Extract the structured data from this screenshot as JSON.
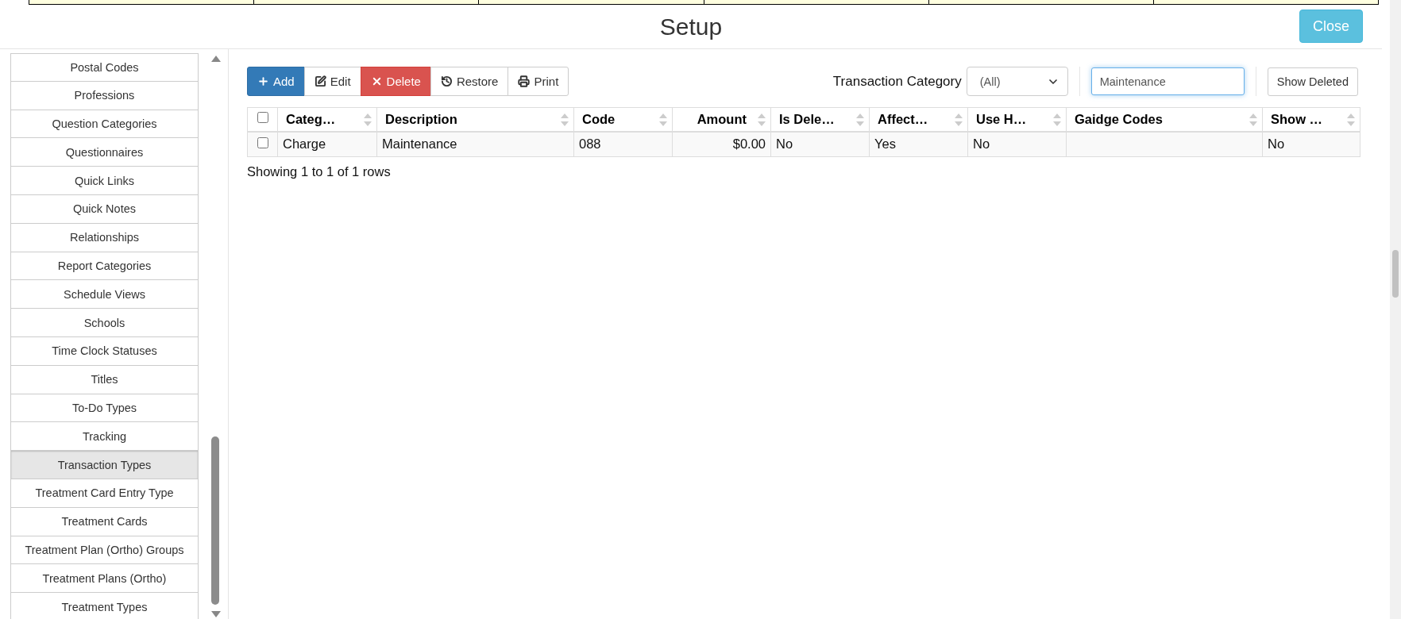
{
  "title": "Setup",
  "close_button": "Close",
  "sidebar": {
    "items": [
      {
        "label": "Postal Codes",
        "selected": false
      },
      {
        "label": "Professions",
        "selected": false
      },
      {
        "label": "Question Categories",
        "selected": false
      },
      {
        "label": "Questionnaires",
        "selected": false
      },
      {
        "label": "Quick Links",
        "selected": false
      },
      {
        "label": "Quick Notes",
        "selected": false
      },
      {
        "label": "Relationships",
        "selected": false
      },
      {
        "label": "Report Categories",
        "selected": false
      },
      {
        "label": "Schedule Views",
        "selected": false
      },
      {
        "label": "Schools",
        "selected": false
      },
      {
        "label": "Time Clock Statuses",
        "selected": false
      },
      {
        "label": "Titles",
        "selected": false
      },
      {
        "label": "To-Do Types",
        "selected": false
      },
      {
        "label": "Tracking",
        "selected": false
      },
      {
        "label": "Transaction Types",
        "selected": true
      },
      {
        "label": "Treatment Card Entry Type",
        "selected": false
      },
      {
        "label": "Treatment Cards",
        "selected": false
      },
      {
        "label": "Treatment Plan (Ortho) Groups",
        "selected": false
      },
      {
        "label": "Treatment Plans (Ortho)",
        "selected": false
      },
      {
        "label": "Treatment Types",
        "selected": false
      }
    ]
  },
  "toolbar": {
    "buttons": [
      {
        "label": "Add",
        "kind": "add"
      },
      {
        "label": "Edit",
        "kind": "edit"
      },
      {
        "label": "Delete",
        "kind": "delete"
      },
      {
        "label": "Restore",
        "kind": "restore"
      },
      {
        "label": "Print",
        "kind": "print"
      }
    ]
  },
  "filter": {
    "label": "Transaction Category",
    "select_value": "(All)",
    "search_value": "Maintenance",
    "show_deleted_button": "Show Deleted"
  },
  "table": {
    "select_all_checked": false,
    "columns": [
      {
        "label": "Categ…",
        "kind": "text"
      },
      {
        "label": "Description",
        "kind": "text"
      },
      {
        "label": "Code",
        "kind": "text"
      },
      {
        "label": "Amount",
        "kind": "amount"
      },
      {
        "label": "Is Dele…",
        "kind": "text"
      },
      {
        "label": "Affect…",
        "kind": "text"
      },
      {
        "label": "Use H…",
        "kind": "text"
      },
      {
        "label": "Gaidge Codes",
        "kind": "text"
      },
      {
        "label": "Show …",
        "kind": "text"
      }
    ],
    "rows": [
      {
        "checked": false,
        "cells": [
          "Charge",
          "Maintenance",
          "088",
          "$0.00",
          "No",
          "Yes",
          "No",
          null,
          "No"
        ]
      }
    ]
  },
  "footer": "Showing 1 to 1 of 1 rows"
}
